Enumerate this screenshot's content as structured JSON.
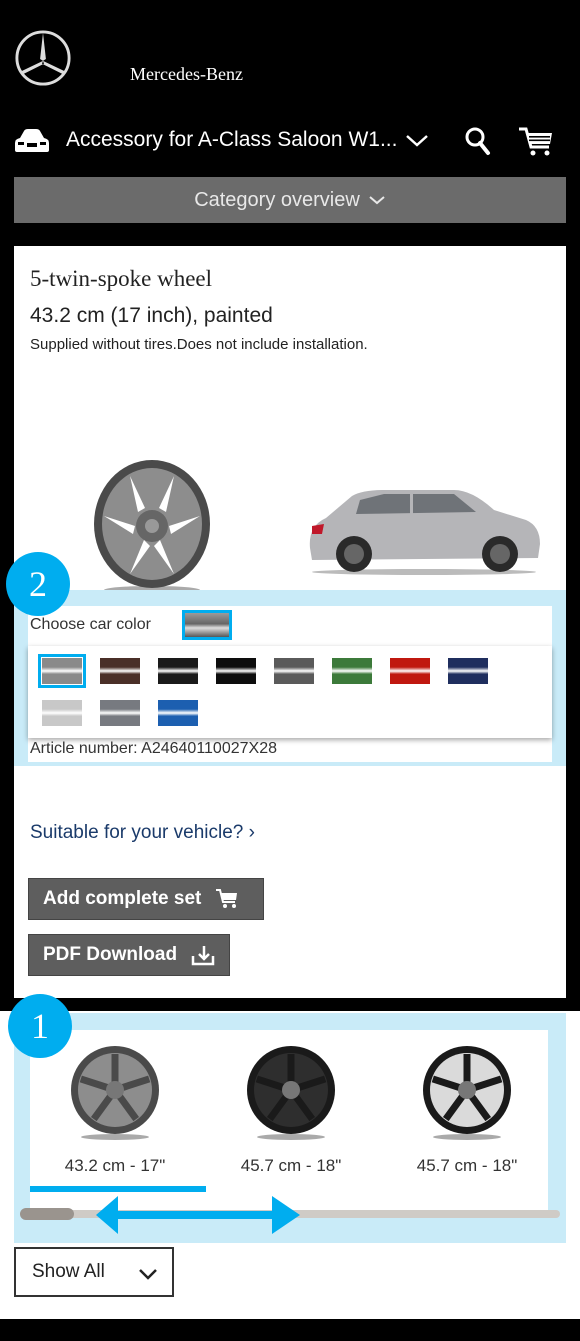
{
  "header": {
    "brand": "Mercedes-Benz",
    "vehicle_selector": "Accessory for A-Class Saloon W1...",
    "icons": [
      "mercedes-star-logo",
      "car-icon",
      "chevron-down-icon",
      "search-icon",
      "cart-icon"
    ]
  },
  "category_nav": {
    "label": "Category overview"
  },
  "product": {
    "title": "5-twin-spoke wheel",
    "subtitle": "43.2 cm (17 inch), painted",
    "note": "Supplied without tires.Does not include installation.",
    "color_picker": {
      "label": "Choose car color",
      "selected_index": 0,
      "swatches": [
        {
          "name": "silver-grey",
          "color": "#8a8a8a"
        },
        {
          "name": "brown",
          "color": "#4a2f28"
        },
        {
          "name": "black-1",
          "color": "#1a1a1a"
        },
        {
          "name": "black-2",
          "color": "#0d0d0d"
        },
        {
          "name": "dark-grey",
          "color": "#5a5a5a"
        },
        {
          "name": "green",
          "color": "#3c7a3a"
        },
        {
          "name": "red",
          "color": "#c0180f"
        },
        {
          "name": "navy-blue",
          "color": "#1f2e5e"
        },
        {
          "name": "light-silver",
          "color": "#c8c8c8"
        },
        {
          "name": "graphite",
          "color": "#777a80"
        },
        {
          "name": "blue",
          "color": "#1c5fb0"
        }
      ]
    },
    "article_number": "Article number: A24640110027X28",
    "suitable_link": "Suitable for your vehicle? ›",
    "add_set_button": "Add complete set",
    "pdf_button": "PDF Download"
  },
  "annotations": {
    "badge_1": "1",
    "badge_2": "2",
    "accent": "#00adef",
    "highlight": "#c9ebf8"
  },
  "carousel": {
    "items": [
      {
        "label": "43.2 cm - 17\"",
        "style": "dark-grey-5-twin-spoke",
        "active": true
      },
      {
        "label": "45.7 cm - 18\"",
        "style": "black-multi-spoke",
        "active": false
      },
      {
        "label": "45.7 cm - 18\"",
        "style": "black-polished-multi-spoke",
        "active": false
      }
    ],
    "scroll_position": 0
  },
  "filter": {
    "selected": "Show All"
  }
}
